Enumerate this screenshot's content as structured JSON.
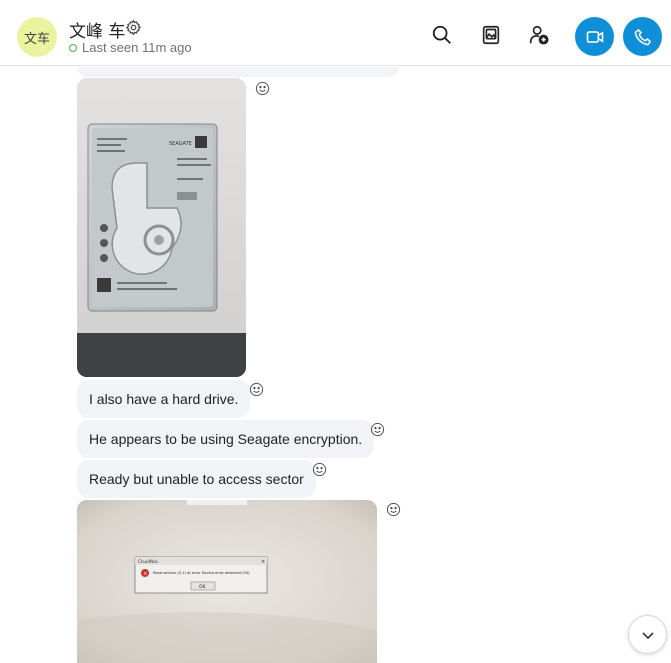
{
  "contact": {
    "avatar_initials": "文车",
    "name": "文峰 车",
    "status": "Last seen 11m ago"
  },
  "header_icons": [
    "search-icon",
    "gallery-icon",
    "add-person-icon",
    "video-call-icon",
    "audio-call-icon"
  ],
  "messages": [
    {
      "type": "image",
      "description_icon": "hard-drive-photo"
    },
    {
      "type": "text",
      "text": "I also have a hard drive."
    },
    {
      "type": "text",
      "text": "He appears to be using Seagate encryption."
    },
    {
      "type": "text",
      "text": "Ready but unable to access sector"
    },
    {
      "type": "image",
      "description_icon": "error-dialog-photo"
    }
  ],
  "photo1": {
    "label_lines": [
      "SEAGATE"
    ]
  },
  "photo2": {
    "dialog_title": "CloudNas",
    "dialog_text": "Read sectors (0-1) at error Device error detected (00)",
    "dialog_ok": "OK"
  },
  "colors": {
    "accent": "#0f8fd8",
    "bubble": "#f1f3f6",
    "avatar": "#ecf3a0",
    "online": "#3fb950"
  }
}
